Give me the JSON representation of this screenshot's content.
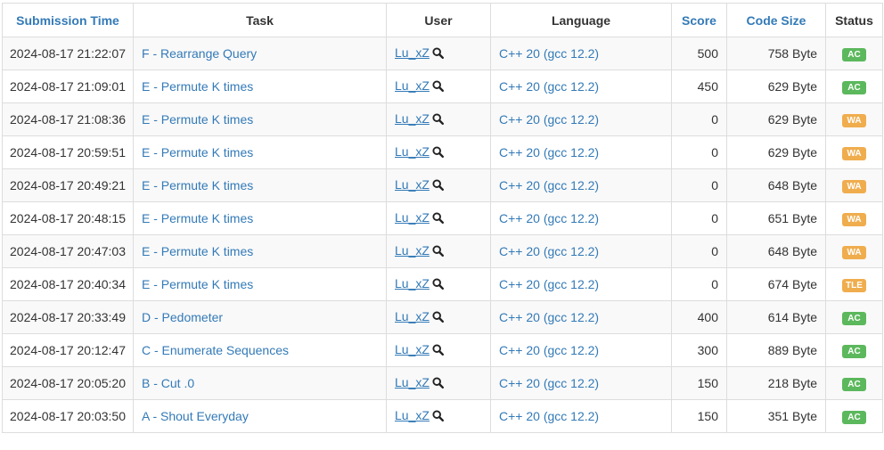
{
  "headers": {
    "submission_time": "Submission Time",
    "task": "Task",
    "user": "User",
    "language": "Language",
    "score": "Score",
    "code_size": "Code Size",
    "status": "Status"
  },
  "colors": {
    "link": "#337ab7",
    "ac": "#5cb85c",
    "wa": "#f0ad4e",
    "tle": "#f0ad4e"
  },
  "rows": [
    {
      "time": "2024-08-17 21:22:07",
      "task": "F - Rearrange Query",
      "user": "Lu_xZ",
      "language": "C++ 20 (gcc 12.2)",
      "score": "500",
      "size": "758 Byte",
      "status": "AC"
    },
    {
      "time": "2024-08-17 21:09:01",
      "task": "E - Permute K times",
      "user": "Lu_xZ",
      "language": "C++ 20 (gcc 12.2)",
      "score": "450",
      "size": "629 Byte",
      "status": "AC"
    },
    {
      "time": "2024-08-17 21:08:36",
      "task": "E - Permute K times",
      "user": "Lu_xZ",
      "language": "C++ 20 (gcc 12.2)",
      "score": "0",
      "size": "629 Byte",
      "status": "WA"
    },
    {
      "time": "2024-08-17 20:59:51",
      "task": "E - Permute K times",
      "user": "Lu_xZ",
      "language": "C++ 20 (gcc 12.2)",
      "score": "0",
      "size": "629 Byte",
      "status": "WA"
    },
    {
      "time": "2024-08-17 20:49:21",
      "task": "E - Permute K times",
      "user": "Lu_xZ",
      "language": "C++ 20 (gcc 12.2)",
      "score": "0",
      "size": "648 Byte",
      "status": "WA"
    },
    {
      "time": "2024-08-17 20:48:15",
      "task": "E - Permute K times",
      "user": "Lu_xZ",
      "language": "C++ 20 (gcc 12.2)",
      "score": "0",
      "size": "651 Byte",
      "status": "WA"
    },
    {
      "time": "2024-08-17 20:47:03",
      "task": "E - Permute K times",
      "user": "Lu_xZ",
      "language": "C++ 20 (gcc 12.2)",
      "score": "0",
      "size": "648 Byte",
      "status": "WA"
    },
    {
      "time": "2024-08-17 20:40:34",
      "task": "E - Permute K times",
      "user": "Lu_xZ",
      "language": "C++ 20 (gcc 12.2)",
      "score": "0",
      "size": "674 Byte",
      "status": "TLE"
    },
    {
      "time": "2024-08-17 20:33:49",
      "task": "D - Pedometer",
      "user": "Lu_xZ",
      "language": "C++ 20 (gcc 12.2)",
      "score": "400",
      "size": "614 Byte",
      "status": "AC"
    },
    {
      "time": "2024-08-17 20:12:47",
      "task": "C - Enumerate Sequences",
      "user": "Lu_xZ",
      "language": "C++ 20 (gcc 12.2)",
      "score": "300",
      "size": "889 Byte",
      "status": "AC"
    },
    {
      "time": "2024-08-17 20:05:20",
      "task": "B - Cut .0",
      "user": "Lu_xZ",
      "language": "C++ 20 (gcc 12.2)",
      "score": "150",
      "size": "218 Byte",
      "status": "AC"
    },
    {
      "time": "2024-08-17 20:03:50",
      "task": "A - Shout Everyday",
      "user": "Lu_xZ",
      "language": "C++ 20 (gcc 12.2)",
      "score": "150",
      "size": "351 Byte",
      "status": "AC"
    }
  ]
}
